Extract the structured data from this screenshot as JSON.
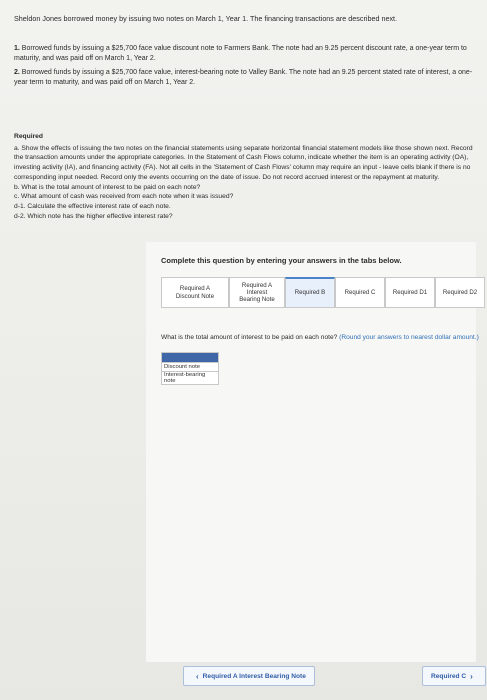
{
  "intro": "Sheldon Jones borrowed money by issuing two notes on March 1, Year 1. The financing transactions are described next.",
  "items": [
    {
      "num": "1.",
      "text": "Borrowed funds by issuing a $25,700 face value discount note to Farmers Bank. The note had an 9.25 percent discount rate, a one-year term to maturity, and was paid off on March 1, Year 2."
    },
    {
      "num": "2.",
      "text": "Borrowed funds by issuing a $25,700 face value, interest-bearing note to Valley Bank. The note had an 9.25 percent stated rate of interest, a one-year term to maturity, and was paid off on March 1, Year 2."
    }
  ],
  "required": {
    "heading": "Required",
    "lines": [
      "a. Show the effects of issuing the two notes on the financial statements using separate horizontal financial statement models like those shown next. Record the transaction amounts under the appropriate categories. In the Statement of Cash Flows column, indicate whether the item is an operating activity (OA), investing activity (IA), and financing activity (FA). Not all cells in the 'Statement of Cash Flows' column may require an input - leave cells blank if there is no corresponding input needed. Record only the events occurring on the date of issue. Do not record accrued interest or the repayment at maturity.",
      "b. What is the total amount of interest to be paid on each note?",
      "c. What amount of cash was received from each note when it was issued?",
      "d-1. Calculate the effective interest rate of each note.",
      "d-2. Which note has the higher effective interest rate?"
    ]
  },
  "complete_label": "Complete this question by entering your answers in the tabs below.",
  "tabs": [
    {
      "label": "Required A Discount Note"
    },
    {
      "label": "Required A Interest Bearing Note"
    },
    {
      "label": "Required B"
    },
    {
      "label": "Required C"
    },
    {
      "label": "Required D1"
    },
    {
      "label": "Required D2"
    }
  ],
  "question": "What is the total amount of interest to be paid on each note?",
  "question_hint": "(Round your answers to nearest dollar amount.)",
  "table_rows": [
    "Discount note",
    "Interest-bearing note"
  ],
  "nav": {
    "prev_label": "Required A Interest Bearing Note",
    "next_label": "Required C"
  },
  "colors": {
    "accent": "#3f67a8",
    "link": "#2f5fa8"
  }
}
